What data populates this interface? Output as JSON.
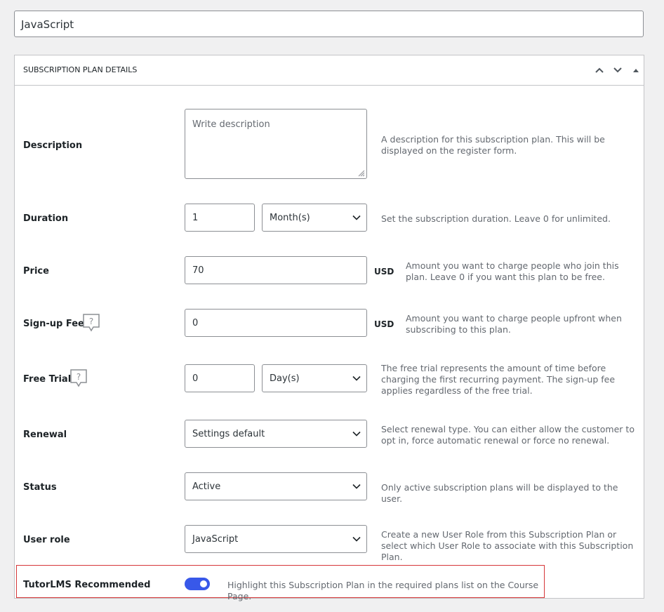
{
  "plan_title": "JavaScript",
  "metabox": {
    "title": "SUBSCRIPTION PLAN DETAILS",
    "icons": [
      "chevron-up-icon",
      "chevron-down-icon",
      "triangle-up-icon"
    ]
  },
  "fields": {
    "description": {
      "label": "Description",
      "placeholder": "Write description",
      "help": "A description for this subscription plan. This will be displayed on the register form."
    },
    "duration": {
      "label": "Duration",
      "value": "1",
      "unit": "Month(s)",
      "help": "Set the subscription duration. Leave 0 for unlimited."
    },
    "price": {
      "label": "Price",
      "value": "70",
      "currency": "USD",
      "help": "Amount you want to charge people who join this plan. Leave 0 if you want this plan to be free."
    },
    "signup_fee": {
      "label": "Sign-up Fee",
      "value": "0",
      "currency": "USD",
      "help": "Amount you want to charge people upfront when subscribing to this plan."
    },
    "free_trial": {
      "label": "Free Trial",
      "value": "0",
      "unit": "Day(s)",
      "help": "The free trial represents the amount of time before charging the first recurring payment. The sign-up fee applies regardless of the free trial."
    },
    "renewal": {
      "label": "Renewal",
      "value": "Settings default",
      "help": "Select renewal type. You can either allow the customer to opt in, force automatic renewal or force no renewal."
    },
    "status": {
      "label": "Status",
      "value": "Active",
      "help": "Only active subscription plans will be displayed to the user."
    },
    "user_role": {
      "label": "User role",
      "value": "JavaScript",
      "help": "Create a new User Role from this Subscription Plan or select which User Role to associate with this Subscription Plan."
    },
    "tutorlms": {
      "label": "TutorLMS Recommended",
      "enabled": true,
      "help": "Highlight this Subscription Plan in the required plans list on the Course Page."
    }
  },
  "colors": {
    "accent": "#3858e9",
    "highlight_border": "#d63638",
    "help_text": "#646970"
  }
}
